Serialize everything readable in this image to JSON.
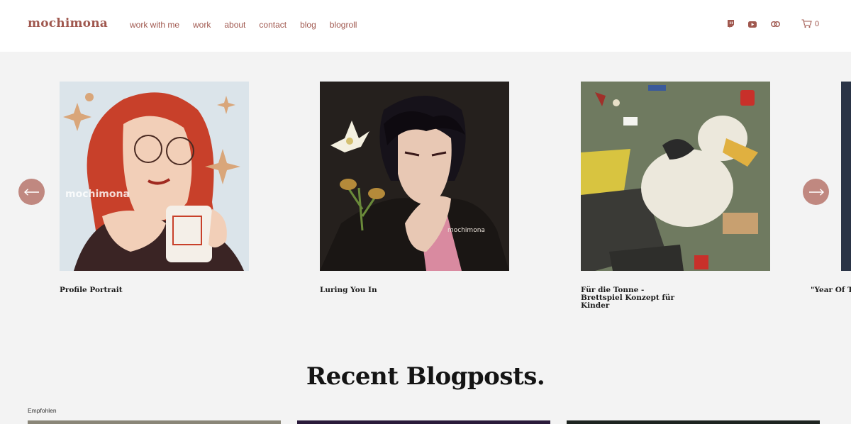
{
  "header": {
    "logo": "mochimona",
    "nav": [
      "work with me",
      "work",
      "about",
      "contact",
      "blog",
      "blogroll"
    ],
    "social_icons": [
      "twitch-icon",
      "youtube-icon",
      "link-icon"
    ],
    "cart_count": "0"
  },
  "carousel": {
    "slides": [
      {
        "caption": "Profile Portrait",
        "watermark": "mochimona"
      },
      {
        "caption": "Luring You In",
        "watermark": "mochimona"
      },
      {
        "caption": "Für die Tonne - Brettspiel Konzept für Kinder"
      },
      {
        "caption": "\"Year Of Th Illustratio"
      }
    ],
    "prev_icon": "arrow-left-icon",
    "next_icon": "arrow-right-icon"
  },
  "blog": {
    "title": "Recent Blogposts.",
    "tag": "Empfohlen"
  },
  "colors": {
    "accent": "#a0584f",
    "arrow_bg": "#c08880",
    "page_bg": "#f3f3f3"
  }
}
